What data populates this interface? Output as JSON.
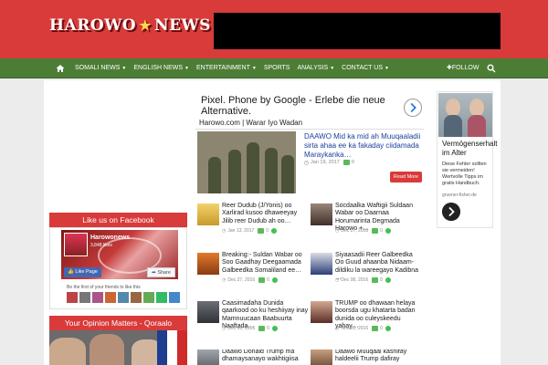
{
  "header": {
    "logo_left": "HAROWO",
    "logo_right": "NEWS"
  },
  "nav": {
    "items": [
      {
        "label": "SOMALI NEWS",
        "dropdown": true
      },
      {
        "label": "ENGLISH NEWS",
        "dropdown": true
      },
      {
        "label": "ENTERTAINMENT",
        "dropdown": true
      },
      {
        "label": "SPORTS",
        "dropdown": false
      },
      {
        "label": "ANALYSIS",
        "dropdown": true
      },
      {
        "label": "CONTACT US",
        "dropdown": true
      }
    ],
    "follow_label": "FOLLOW"
  },
  "main_ad": {
    "title": "Pixel. Phone by Google - Erlebe die neue Alternative."
  },
  "section_title": "Harowo.com | Warar Iyo Wadan",
  "feature": {
    "title": "DAAWO Mid ka mid ah Muuqaaladii sirta ahaa ee ka fakaday ciidamada Maraykanka…",
    "date": "Jan 19, 2017",
    "comments": "0",
    "read_more": "Read More"
  },
  "posts": [
    {
      "title": "Reer Dudub (J/Yonis) oo Xarlirad kusoo dhaweeyay Jilib reer Dudub ah oo…",
      "date": "Jan 13, 2017",
      "comments": "0"
    },
    {
      "title": "Socdaalka Waftigii Suldaan Wabar oo Daarnaa Horumarinta Degmada Harowo +…",
      "date": "Dec 27, 2016",
      "comments": "0"
    },
    {
      "title": "Breaking:- Suldan Wabar oo Soo Gaadhay Deegaamada Galbeedka Somaliland ee…",
      "date": "Dec 27, 2016",
      "comments": "0"
    },
    {
      "title": "Siyaasadii Reer Galbeedka Oo Guud ahaanba Nidaam-dildiku la wareegayo Kadibna …",
      "date": "Dec 08, 2016",
      "comments": "0"
    },
    {
      "title": "Caasimadaha Dunida qaarkood oo ku heshiiyay inay Mamnuucaan Baabuurta Naaftada…",
      "date": "Dec 03, 2016",
      "comments": "0"
    },
    {
      "title": "TRUMP oo dhawaan helaya boorsda ugu khatarta badan dunida oo culeyskeedu yahay…",
      "date": "Nov 22, 2016",
      "comments": "0"
    },
    {
      "title": "Daawo Donald Trump ma dhamaysanayo wakhtigiisa",
      "date": "",
      "comments": ""
    },
    {
      "title": "Daawo Muuqaal kashifay haldeelii Trump dafiray",
      "date": "",
      "comments": ""
    }
  ],
  "sidebar": {
    "facebook_head": "Like us on Facebook",
    "fb_page_name": "Harowonews",
    "fb_likes": "3,848 likes",
    "fb_like_btn": "Like Page",
    "fb_share_btn": "Share",
    "fb_friends": "Be the first of your friends to like this",
    "opinion_head": "Your Opinion Matters - Qoraalo"
  },
  "right_ad": {
    "title": "Vermögenserhalt im Alter",
    "text": "Diese Fehler sollten sie vermeiden! Wertvolle Tipps im gratis Handbuch.",
    "url": "gruener-fisher.de"
  },
  "colors": {
    "header_red": "#d93a3a",
    "nav_green": "#4c7d35",
    "link_blue": "#1a3f9c",
    "accent_red": "#d93a3a"
  },
  "icons": {
    "home": "home-icon",
    "follow": "plus-icon",
    "search": "search-icon",
    "clock": "clock-icon",
    "comment": "comment-icon"
  }
}
